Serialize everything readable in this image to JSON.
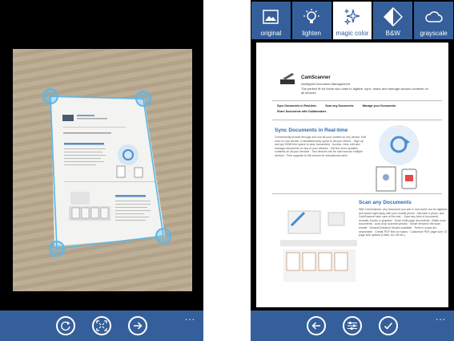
{
  "left_screen": {
    "app_bar": {
      "buttons": [
        {
          "icon": "rotate-icon"
        },
        {
          "icon": "fit-borders-icon"
        },
        {
          "icon": "arrow-right-icon"
        }
      ],
      "more": "..."
    }
  },
  "right_screen": {
    "filters": [
      {
        "label": "original",
        "icon": "image-icon"
      },
      {
        "label": "lighten",
        "icon": "bulb-icon"
      },
      {
        "label": "magic color",
        "icon": "sparkle-icon",
        "selected": true
      },
      {
        "label": "B&W",
        "icon": "contrast-icon"
      },
      {
        "label": "grayscale",
        "icon": "cloud-icon"
      }
    ],
    "document": {
      "title": "CamScanner",
      "tagline": "Intelligent Document Management",
      "intro": "The perfect fit for those who want to digitize, sync, share and manage various contents on all devices",
      "nav": [
        "Sync Documents in Real-time",
        "Scan any Documents",
        "Manage your Documents"
      ],
      "nav_sub": "Share Documents with Collaborators",
      "section1_title": "Sync Documents in Real-time",
      "section1_text": "Conveniently browse through and use all your content on any device. Edit once on one device, it simultaneously syncs to all your others. · Sign up and get 200M free space to save documents · Access, view, edit and manage documents on any of your devices · Get the most updated contents on all your devices · Two devices can be used across multiple devices · Free upgrade to full version for educational users",
      "section2_title": "Scan any Documents",
      "section2_text": "With CamScanner, any document you see in real world can be digitized and saved right away with your mobile phone. Just take a photo, and CamScanner take care of the rest. · Scan any kind of document, receipts, books or graphics · Scan multi-page documents · Batch scan documents · Auto-crop scanned photos · Smart enhance the scan results · Several Enhance Modes available · Texts in scans are searchable · Create PDF files for scans · Customize PDF page size: 10 page size options (Letter, A4, A5 etc.)"
    },
    "app_bar": {
      "buttons": [
        {
          "icon": "arrow-left-icon"
        },
        {
          "icon": "settings-sliders-icon"
        },
        {
          "icon": "checkmark-icon"
        }
      ],
      "more": "..."
    }
  },
  "colors": {
    "app_bar": "#355f9a",
    "accent": "#5db7e8",
    "screen_bg": "#000000"
  }
}
